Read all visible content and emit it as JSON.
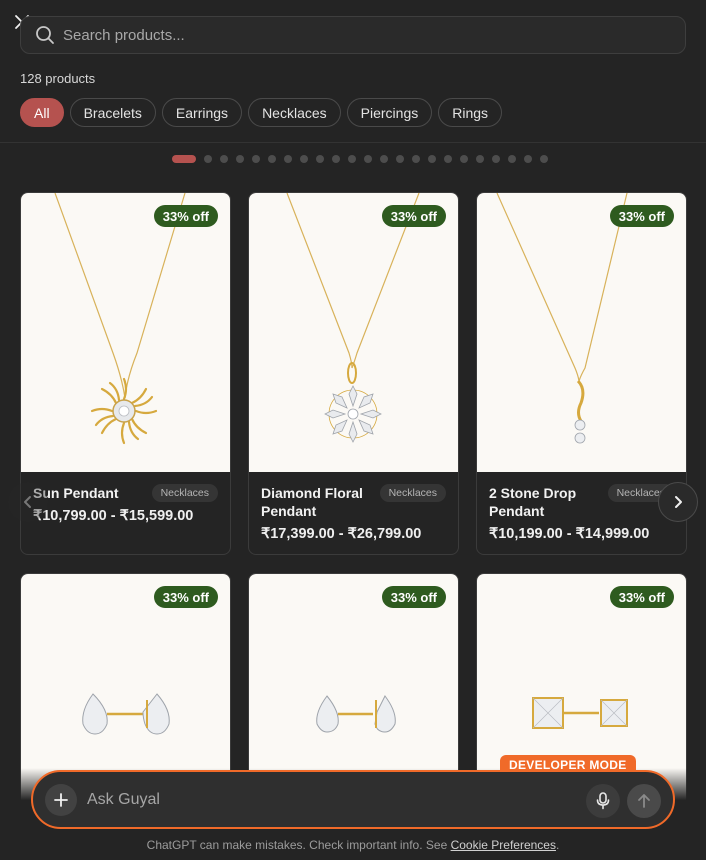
{
  "search": {
    "placeholder": "Search products..."
  },
  "product_count": "128 products",
  "filters": [
    {
      "label": "All",
      "active": true
    },
    {
      "label": "Bracelets"
    },
    {
      "label": "Earrings"
    },
    {
      "label": "Necklaces"
    },
    {
      "label": "Piercings"
    },
    {
      "label": "Rings"
    }
  ],
  "carousel": {
    "total_pages": 23,
    "current_page": 1
  },
  "products": [
    {
      "name": "Sun Pendant",
      "category": "Necklaces",
      "price": "₹10,799.00 - ₹15,599.00",
      "badge": "33% off",
      "image": "sun-pendant"
    },
    {
      "name": "Diamond Floral Pendant",
      "category": "Necklaces",
      "price": "₹17,399.00 - ₹26,799.00",
      "badge": "33% off",
      "image": "floral-pendant"
    },
    {
      "name": "2 Stone Drop Pendant",
      "category": "Necklaces",
      "price": "₹10,199.00 - ₹14,999.00",
      "badge": "33% off",
      "image": "drop-pendant"
    },
    {
      "name": "",
      "category": "",
      "price": "",
      "badge": "33% off",
      "image": "pear-studs"
    },
    {
      "name": "",
      "category": "",
      "price": "",
      "badge": "33% off",
      "image": "pear-studs-2"
    },
    {
      "name": "",
      "category": "",
      "price": "",
      "badge": "33% off",
      "image": "princess-studs"
    }
  ],
  "dev_mode_label": "DEVELOPER MODE",
  "composer": {
    "placeholder": "Ask Guyal"
  },
  "disclaimer": {
    "text": "ChatGPT can make mistakes. Check important info. See",
    "link": "Cookie Preferences",
    "suffix": "."
  },
  "colors": {
    "accent": "#b5524f",
    "badge": "#2e5b1f",
    "dev_orange": "#f06a29"
  }
}
